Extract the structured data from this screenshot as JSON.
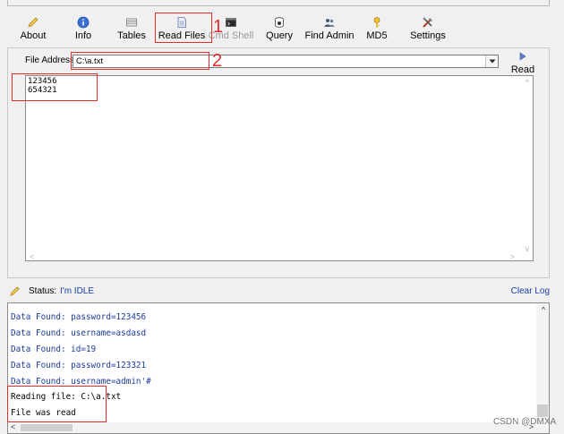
{
  "toolbar": {
    "about": "About",
    "info": "Info",
    "tables": "Tables",
    "read_files": "Read Files",
    "cmd_shell": "Cmd Shell",
    "query": "Query",
    "find_admin": "Find Admin",
    "md5": "MD5",
    "settings": "Settings"
  },
  "annotations": {
    "mark1": "1",
    "mark2": "2"
  },
  "file_reader": {
    "address_label": "File Address:",
    "address_value": "C:\\a.txt",
    "read_button": "Read",
    "content_lines": [
      "123456",
      "654321"
    ]
  },
  "status": {
    "label": "Status:",
    "value": "I'm IDLE",
    "clear_log": "Clear Log"
  },
  "log": [
    {
      "text": "Data Found: password=123456",
      "kind": "data"
    },
    {
      "text": "Data Found: username=asdasd",
      "kind": "data"
    },
    {
      "text": "Data Found: id=19",
      "kind": "data"
    },
    {
      "text": "Data Found: password=123321",
      "kind": "data"
    },
    {
      "text": "Data Found: username=admin'#",
      "kind": "data"
    },
    {
      "text": "Reading file: C:\\a.txt",
      "kind": "info"
    },
    {
      "text": "File was read",
      "kind": "info"
    }
  ],
  "watermark": "CSDN @DMXA",
  "colors": {
    "annotation_red": "#e22d2d",
    "link_blue": "#1a3fa8",
    "log_blue": "#1b3b9a"
  }
}
